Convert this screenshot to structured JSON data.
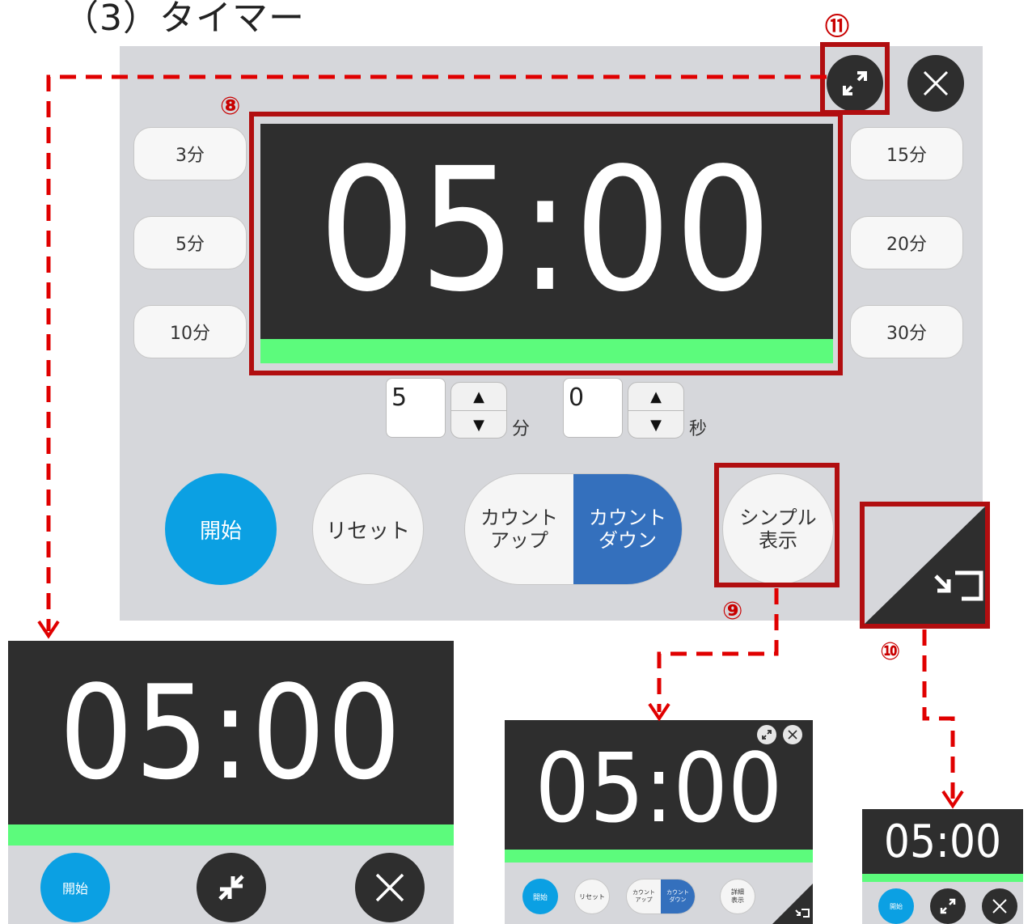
{
  "heading": "（3）タイマー",
  "timer_display": "05:00",
  "presets_left": [
    "3分",
    "5分",
    "10分"
  ],
  "presets_right": [
    "15分",
    "20分",
    "30分"
  ],
  "minutes": {
    "value": "5",
    "unit": "分"
  },
  "seconds": {
    "value": "0",
    "unit": "秒"
  },
  "stepper": {
    "up": "▲",
    "down": "▼"
  },
  "buttons": {
    "start": "開始",
    "reset": "リセット",
    "count_up": "カウント\nアップ",
    "count_down": "カウント\nダウン",
    "simple": "シンプル\n表示"
  },
  "markers": {
    "m8": "⑧",
    "m9": "⑨",
    "m10": "⑩",
    "m11": "⑪"
  },
  "preview_simple": {
    "display": "05:00",
    "start": "開始"
  },
  "preview_compact": {
    "display": "05:00",
    "start": "開始",
    "reset": "リセット",
    "count_up": "カウント\nアップ",
    "count_down": "カウント\nダウン",
    "detail": "詳細\n表示"
  },
  "preview_mini": {
    "display": "05:00",
    "start": "開始"
  },
  "colors": {
    "accent_red": "#b10e10",
    "start_blue": "#0ba0e3",
    "mode_blue": "#3470bd",
    "progress_green": "#5cfb7c",
    "display_dark": "#2e2e2e"
  },
  "progress": 1.0
}
